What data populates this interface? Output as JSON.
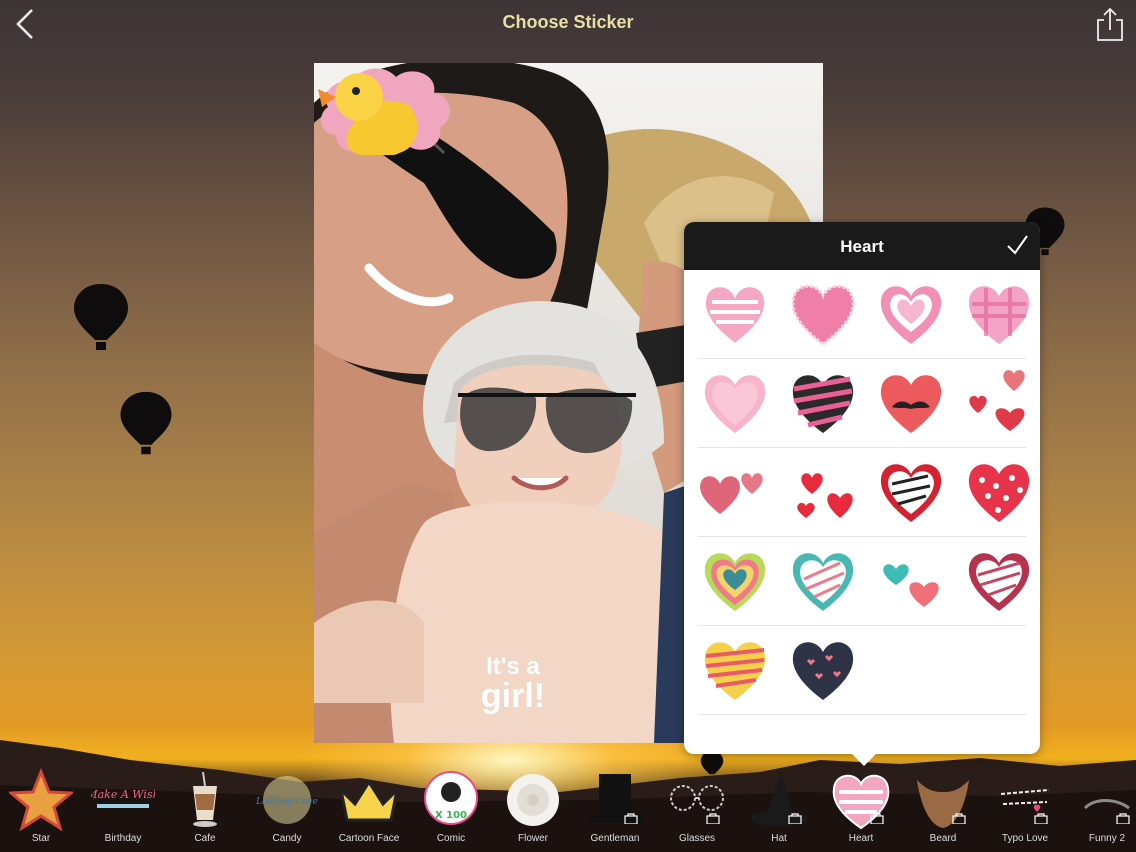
{
  "header": {
    "title": "Choose Sticker",
    "back_icon": "chevron-left-icon",
    "share_icon": "share-icon"
  },
  "photo": {
    "sticker_cloud_line1": "It's a",
    "sticker_cloud_line2": "girl!"
  },
  "panel": {
    "title": "Heart",
    "confirm_icon": "checkmark-icon",
    "stickers": [
      "heart-striped-pink",
      "heart-pink-lace",
      "heart-pink-outline",
      "heart-pink-plaid",
      "heart-light-pink",
      "heart-black-pink-stripes",
      "heart-red-mustache",
      "hearts-scatter-red",
      "hearts-glitter-pair",
      "hearts-small-red",
      "heart-red-zigzag",
      "heart-red-polka",
      "heart-rainbow-layers",
      "heart-teal-stripes",
      "hearts-teal-coral",
      "heart-maroon-stripes",
      "heart-yellow-stripes",
      "heart-navy-hearts"
    ]
  },
  "toolbar": {
    "items": [
      {
        "label": "Star",
        "locked": false
      },
      {
        "label": "Birthday",
        "locked": false,
        "art_text": "Make A Wish"
      },
      {
        "label": "Cafe",
        "locked": false
      },
      {
        "label": "Candy",
        "locked": false,
        "art_text": "Lollipop Love"
      },
      {
        "label": "Cartoon Face",
        "locked": false
      },
      {
        "label": "Comic",
        "locked": false,
        "art_text": "X 100"
      },
      {
        "label": "Flower",
        "locked": false
      },
      {
        "label": "Gentleman",
        "locked": true
      },
      {
        "label": "Glasses",
        "locked": true
      },
      {
        "label": "Hat",
        "locked": true
      },
      {
        "label": "Heart",
        "locked": true,
        "selected": true
      },
      {
        "label": "Beard",
        "locked": true
      },
      {
        "label": "Typo Love",
        "locked": true
      },
      {
        "label": "Funny 2",
        "locked": true
      }
    ]
  },
  "colors": {
    "title": "#e7dfa4",
    "panel_header": "#1a1a1a",
    "heart_pink": "#f4a6c1",
    "heart_red": "#e8344a"
  }
}
